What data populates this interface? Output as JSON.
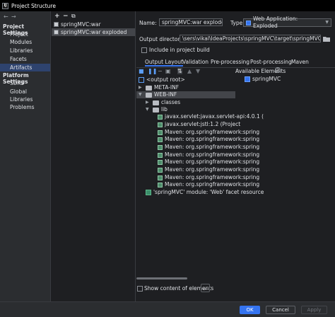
{
  "window": {
    "title": "Project Structure",
    "app_icon": "IJ"
  },
  "nav": {
    "back_icon": "←",
    "forward_icon": "→",
    "project_settings_header": "Project Settings",
    "project_items": [
      "Project",
      "Modules",
      "Libraries",
      "Facets",
      "Artifacts"
    ],
    "selected": "Artifacts",
    "platform_settings_header": "Platform Settings",
    "platform_items": [
      "SDKs",
      "Global Libraries"
    ],
    "problems": "Problems"
  },
  "artifacts": {
    "toolbar": {
      "add": "+",
      "remove": "−",
      "copy": "⧉"
    },
    "items": [
      "springMVC:war",
      "springMVC:war exploded"
    ],
    "selected_index": 1
  },
  "details": {
    "name_label": "Name:",
    "name_value": "springMVC:war exploded",
    "type_label": "Type:",
    "type_value": "Web Application: Exploded",
    "output_dir_label": "Output directory:",
    "output_dir_value": "\\sers\\vikal\\IdeaProjects\\springMVC\\target\\springMVC-1.0-SNAPSHOT",
    "include_in_build_label": "Include in project build",
    "include_in_build_checked": false,
    "tabs": [
      "Output Layout",
      "Validation",
      "Pre-processing",
      "Post-processing",
      "Maven"
    ],
    "active_tab": "Output Layout"
  },
  "layout_tree": {
    "rows": [
      {
        "label": "<output root>",
        "icon": "output-root"
      },
      {
        "label": "META-INF",
        "icon": "folder",
        "expander": "▶"
      },
      {
        "label": "WEB-INF",
        "icon": "folder",
        "expander": "▼"
      },
      {
        "label": "classes",
        "icon": "folder",
        "expander": "▶"
      },
      {
        "label": "lib",
        "icon": "folder",
        "expander": "▼"
      },
      {
        "label": "javax.servlet:javax.servlet-api:4.0.1 (",
        "icon": "jar"
      },
      {
        "label": "javax.servlet:jstl:1.2 (Project",
        "icon": "jar"
      },
      {
        "label": "Maven: org.springframework:spring",
        "icon": "jar"
      },
      {
        "label": "Maven: org.springframework:spring",
        "icon": "jar"
      },
      {
        "label": "Maven: org.springframework:spring",
        "icon": "jar"
      },
      {
        "label": "Maven: org.springframework:spring",
        "icon": "jar"
      },
      {
        "label": "Maven: org.springframework:spring",
        "icon": "jar"
      },
      {
        "label": "Maven: org.springframework:spring",
        "icon": "jar"
      },
      {
        "label": "Maven: org.springframework:spring",
        "icon": "jar"
      },
      {
        "label": "Maven: org.springframework:spring",
        "icon": "jar"
      },
      {
        "label": "'springMVC' module: 'Web' facet resource",
        "icon": "module"
      }
    ],
    "selected_index": 2,
    "show_content_label": "Show content of elements",
    "show_content_checked": false,
    "more_button": "..."
  },
  "available": {
    "header": "Available Elements",
    "help_icon": "?",
    "items": [
      "springMVC"
    ]
  },
  "footer": {
    "ok": "OK",
    "cancel": "Cancel",
    "apply": "Apply"
  },
  "colors": {
    "accent": "#3574f0",
    "selection": "#2e436e",
    "background": "#1e1f22",
    "panel": "#2b2d30"
  }
}
